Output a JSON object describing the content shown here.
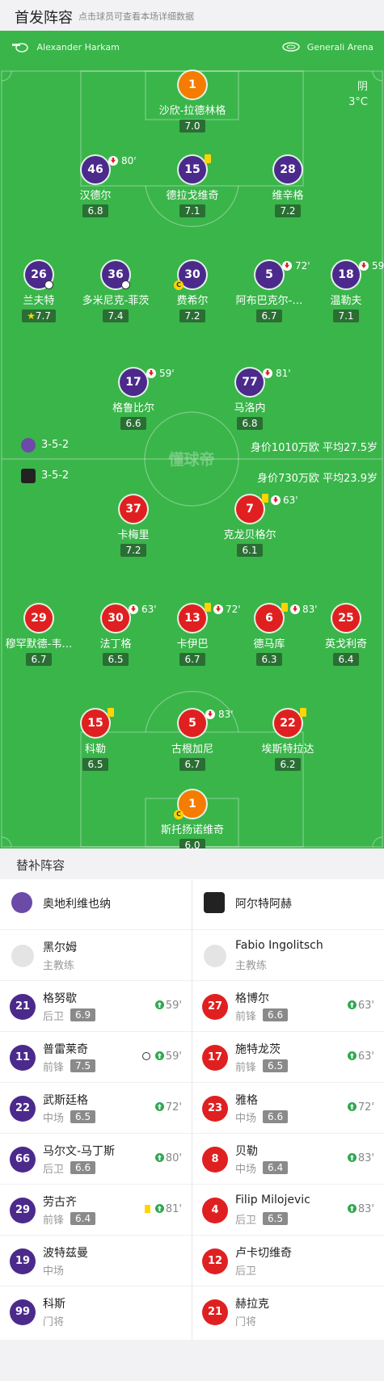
{
  "header": {
    "title": "首发阵容",
    "subtitle": "点击球员可查看本场详细数据"
  },
  "match": {
    "referee": "Alexander Harkam",
    "stadium": "Generali Arena",
    "weather": "阴",
    "temperature": "3°C"
  },
  "home": {
    "formation": "3-5-2",
    "value_text": "身价1010万欧  平均27.5岁",
    "players": [
      {
        "num": "1",
        "name": "沙欣-拉德林格",
        "rating": "7.0",
        "color": "orange"
      },
      {
        "num": "46",
        "name": "汉德尔",
        "rating": "6.8",
        "color": "purple",
        "sub_min": "80'"
      },
      {
        "num": "15",
        "name": "德拉戈维奇",
        "rating": "7.1",
        "color": "purple",
        "yellow": true
      },
      {
        "num": "28",
        "name": "维辛格",
        "rating": "7.2",
        "color": "purple"
      },
      {
        "num": "26",
        "name": "兰夫特",
        "rating": "7.7",
        "color": "purple",
        "goal": true,
        "star": true
      },
      {
        "num": "36",
        "name": "多米尼克-菲茨",
        "rating": "7.4",
        "color": "purple",
        "goal": true
      },
      {
        "num": "30",
        "name": "费希尔",
        "rating": "7.2",
        "color": "purple",
        "captain": true
      },
      {
        "num": "5",
        "name": "阿布巴克尔-…",
        "rating": "6.7",
        "color": "purple",
        "sub_min": "72'"
      },
      {
        "num": "18",
        "name": "温勒夫",
        "rating": "7.1",
        "color": "purple",
        "sub_min": "59'"
      },
      {
        "num": "17",
        "name": "格鲁比尔",
        "rating": "6.6",
        "color": "purple",
        "sub_min": "59'"
      },
      {
        "num": "77",
        "name": "马洛内",
        "rating": "6.8",
        "color": "purple",
        "sub_min": "81'"
      }
    ]
  },
  "away": {
    "formation": "3-5-2",
    "value_text": "身价730万欧    平均23.9岁",
    "players": [
      {
        "num": "37",
        "name": "卡梅里",
        "rating": "7.2",
        "color": "red"
      },
      {
        "num": "7",
        "name": "克龙贝格尔",
        "rating": "6.1",
        "color": "red",
        "yellow": true,
        "sub_min": "63'"
      },
      {
        "num": "29",
        "name": "穆罕默德-韦…",
        "rating": "6.7",
        "color": "red"
      },
      {
        "num": "30",
        "name": "法丁格",
        "rating": "6.5",
        "color": "red",
        "sub_min": "63'"
      },
      {
        "num": "13",
        "name": "卡伊巴",
        "rating": "6.7",
        "color": "red",
        "yellow": true,
        "sub_min": "72'"
      },
      {
        "num": "6",
        "name": "德马库",
        "rating": "6.3",
        "color": "red",
        "yellow": true,
        "sub_min": "83'"
      },
      {
        "num": "25",
        "name": "英戈利奇",
        "rating": "6.4",
        "color": "red"
      },
      {
        "num": "15",
        "name": "科勒",
        "rating": "6.5",
        "color": "red",
        "yellow": true
      },
      {
        "num": "5",
        "name": "古根加尼",
        "rating": "6.7",
        "color": "red",
        "sub_min": "83'"
      },
      {
        "num": "22",
        "name": "埃斯特拉达",
        "rating": "6.2",
        "color": "red",
        "yellow": true
      },
      {
        "num": "1",
        "name": "斯托扬诺维奇",
        "rating": "6.0",
        "color": "orange",
        "captain": true
      }
    ]
  },
  "subs": {
    "title": "替补阵容",
    "home_team": "奥地利维也纳",
    "away_team": "阿尔特阿赫",
    "home_coach": {
      "name": "黑尔姆",
      "role": "主教练"
    },
    "away_coach": {
      "name": "Fabio Ingolitsch",
      "role": "主教练"
    },
    "home": [
      {
        "num": "21",
        "name": "格努歇",
        "pos": "后卫",
        "rating": "6.9",
        "min": "59'"
      },
      {
        "num": "11",
        "name": "普雷莱奇",
        "pos": "前锋",
        "rating": "7.5",
        "min": "59'",
        "goal": true
      },
      {
        "num": "22",
        "name": "武斯廷格",
        "pos": "中场",
        "rating": "6.5",
        "min": "72'"
      },
      {
        "num": "66",
        "name": "马尔文-马丁斯",
        "pos": "后卫",
        "rating": "6.6",
        "min": "80'"
      },
      {
        "num": "29",
        "name": "劳古齐",
        "pos": "前锋",
        "rating": "6.4",
        "min": "81'",
        "yellow": true
      },
      {
        "num": "19",
        "name": "波特兹曼",
        "pos": "中场"
      },
      {
        "num": "99",
        "name": "科斯",
        "pos": "门将"
      }
    ],
    "away": [
      {
        "num": "27",
        "name": "格博尔",
        "pos": "前锋",
        "rating": "6.6",
        "min": "63'"
      },
      {
        "num": "17",
        "name": "施特龙茨",
        "pos": "前锋",
        "rating": "6.5",
        "min": "63'"
      },
      {
        "num": "23",
        "name": "雅格",
        "pos": "中场",
        "rating": "6.6",
        "min": "72'"
      },
      {
        "num": "8",
        "name": "贝勒",
        "pos": "中场",
        "rating": "6.4",
        "min": "83'"
      },
      {
        "num": "4",
        "name": "Filip Milojevic",
        "pos": "后卫",
        "rating": "6.5",
        "min": "83'"
      },
      {
        "num": "12",
        "name": "卢卡切维奇",
        "pos": "后卫"
      },
      {
        "num": "21",
        "name": "赫拉克",
        "pos": "门将"
      }
    ]
  },
  "watermark": "懂球帝",
  "colors": {
    "pitch": "#3ab54a",
    "home": "#4b2a8c",
    "away": "#e02020",
    "keeper": "#f57c00"
  }
}
